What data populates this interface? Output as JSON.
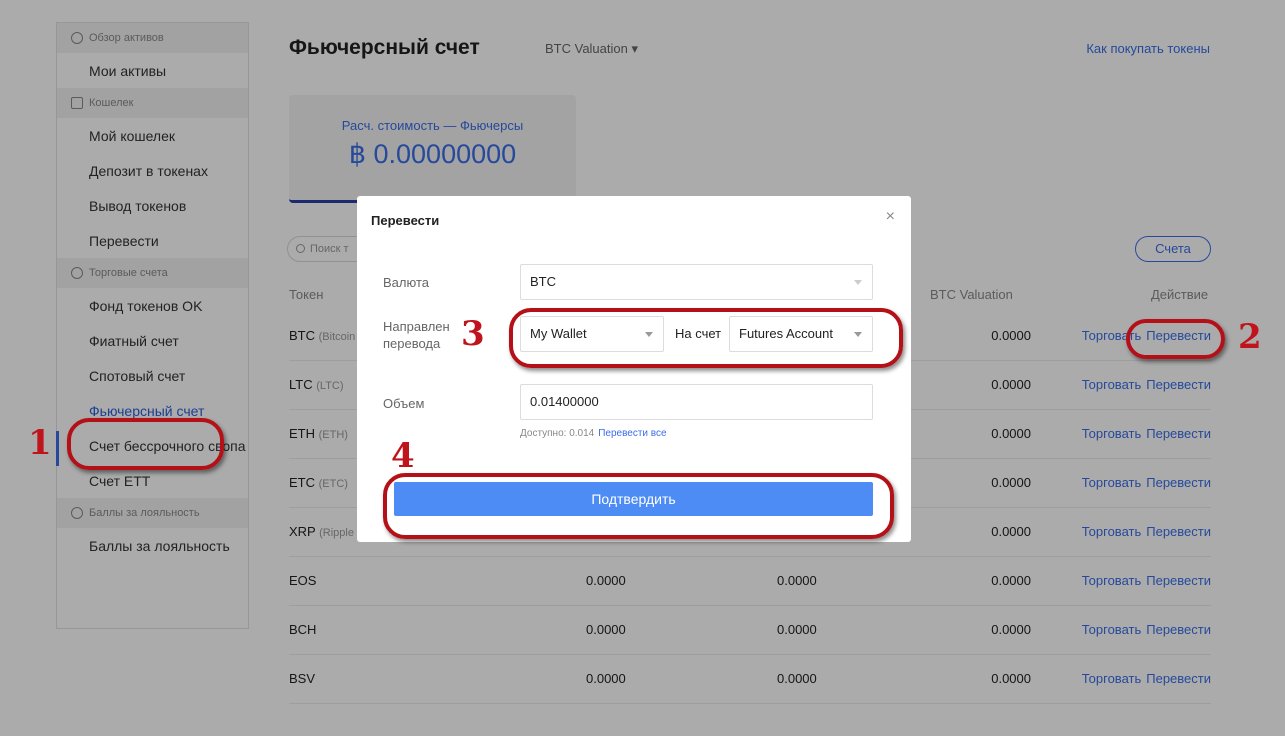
{
  "sidebar": {
    "groups": [
      {
        "title": "Обзор активов",
        "items": [
          "Мои активы"
        ]
      },
      {
        "title": "Кошелек",
        "items": [
          "Мой кошелек",
          "Депозит в токенах",
          "Вывод токенов",
          "Перевести"
        ]
      },
      {
        "title": "Торговые счета",
        "items": [
          "Фонд токенов OK",
          "Фиатный счет",
          "Спотовый счет",
          "Фьючерсный счет",
          "Счет бессрочного свопа",
          "Счет ETT"
        ]
      },
      {
        "title": "Баллы за лояльность",
        "items": [
          "Баллы за лояльность"
        ]
      }
    ],
    "active_item": "Фьючерсный счет"
  },
  "header": {
    "title": "Фьючерсный счет",
    "valuation_dropdown": "BTC Valuation ▾",
    "how_to_buy": "Как покупать токены"
  },
  "card": {
    "label": "Расч. стоимость — Фьючерсы",
    "value": "฿ 0.00000000"
  },
  "search": {
    "placeholder": "Поиск т"
  },
  "accounts_button": "Счета",
  "table": {
    "headers": {
      "token": "Токен",
      "valuation": "BTC Valuation",
      "action": "Действие"
    },
    "rows": [
      {
        "token": "BTC",
        "sub": "(Bitcoin",
        "v1": "",
        "v2": "",
        "v3": "0.0000"
      },
      {
        "token": "LTC",
        "sub": "(LTC)",
        "v1": "",
        "v2": "",
        "v3": "0.0000"
      },
      {
        "token": "ETH",
        "sub": "(ETH)",
        "v1": "",
        "v2": "",
        "v3": "0.0000"
      },
      {
        "token": "ETC",
        "sub": "(ETC)",
        "v1": "",
        "v2": "",
        "v3": "0.0000"
      },
      {
        "token": "XRP",
        "sub": "(Ripple",
        "v1": "",
        "v2": "",
        "v3": "0.0000"
      },
      {
        "token": "EOS",
        "sub": "",
        "v1": "0.0000",
        "v2": "0.0000",
        "v3": "0.0000"
      },
      {
        "token": "BCH",
        "sub": "",
        "v1": "0.0000",
        "v2": "0.0000",
        "v3": "0.0000"
      },
      {
        "token": "BSV",
        "sub": "",
        "v1": "0.0000",
        "v2": "0.0000",
        "v3": "0.0000"
      }
    ],
    "trade_label": "Торговать",
    "transfer_label": "Перевести"
  },
  "modal": {
    "title": "Перевести",
    "close": "×",
    "currency_label": "Валюта",
    "currency_value": "BTC",
    "direction_label_1": "Направлен",
    "direction_label_2": "перевода",
    "from_value": "My Wallet",
    "to_label": "На счет",
    "to_value": "Futures Account",
    "amount_label": "Объем",
    "amount_value": "0.01400000",
    "available_text": "Доступно: 0.014",
    "transfer_all": "Перевести все",
    "confirm": "Подтвердить"
  },
  "annotations": {
    "n1": "1",
    "n2": "2",
    "n3": "3",
    "n4": "4"
  },
  "colors": {
    "accent": "#3a6ee8",
    "annotation": "#b31017",
    "confirm": "#4d8cf5"
  }
}
